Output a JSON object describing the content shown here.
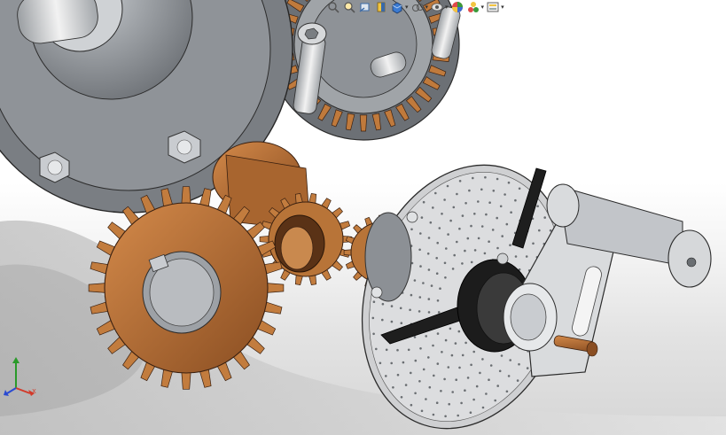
{
  "toolbar": {
    "buttons": [
      {
        "name": "zoom-to-fit",
        "icon": "zoom-to-fit-icon"
      },
      {
        "name": "zoom-to-area",
        "icon": "zoom-to-area-icon"
      },
      {
        "name": "previous-view",
        "icon": "previous-view-icon"
      },
      {
        "name": "section-view",
        "icon": "section-view-icon"
      },
      {
        "name": "view-orientation",
        "icon": "view-orientation-icon",
        "dropdown": true
      },
      {
        "name": "display-style",
        "icon": "display-style-icon",
        "dropdown": true
      },
      {
        "name": "hide-show-items",
        "icon": "hide-show-items-icon",
        "dropdown": true
      },
      {
        "name": "edit-appearance",
        "icon": "edit-appearance-icon"
      },
      {
        "name": "apply-scene",
        "icon": "apply-scene-icon",
        "dropdown": true
      },
      {
        "name": "view-settings",
        "icon": "view-settings-icon",
        "dropdown": true
      }
    ],
    "dropdown_glyph": "▾"
  },
  "triad": {
    "x_label": "X",
    "y_label": "Y",
    "z_label": "Z",
    "colors": {
      "x": "#d23a2a",
      "y": "#2a9a2a",
      "z": "#2a4ad2"
    }
  },
  "colors": {
    "bronze": "#b06a32",
    "bronze_dark": "#7a4420",
    "steel": "#8d9196",
    "steel_light": "#c9ccd0",
    "dial": "#d8d8d8",
    "handle": "#1e1e1e"
  }
}
